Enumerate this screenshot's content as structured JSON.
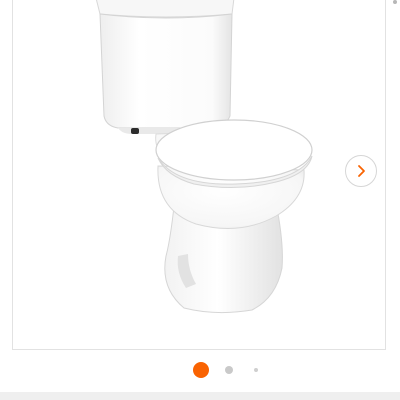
{
  "carousel": {
    "image_icon": "toilet-product-image",
    "next_icon": "chevron-right-icon",
    "slides_total": 3,
    "active_index": 0
  },
  "colors": {
    "accent": "#f96302",
    "inactive_dot": "#c9c9c9",
    "third_dot": "#cfcfcf",
    "chevron": "#f96302",
    "porcelain": "#ffffff",
    "porcelain_shade": "#e6e6e6",
    "bottom_bar": "#efefef"
  }
}
